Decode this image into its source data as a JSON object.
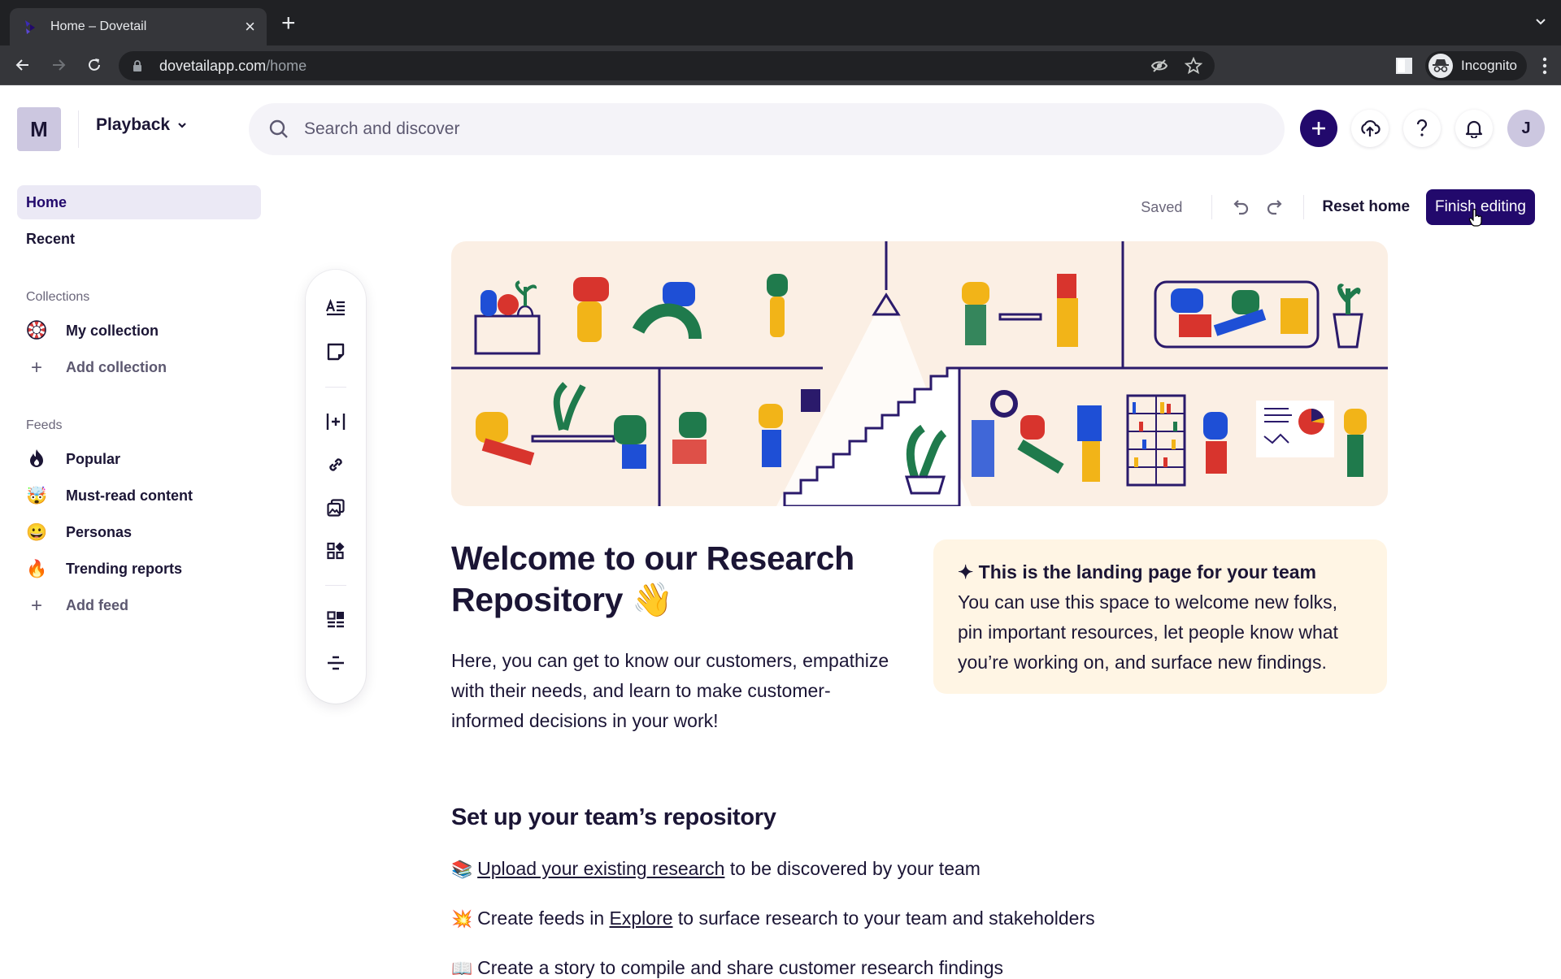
{
  "browser": {
    "tab_title": "Home – Dovetail",
    "new_tab_symbol": "+",
    "close_symbol": "×",
    "url_host": "dovetailapp.com",
    "url_path": "/home",
    "incognito_label": "Incognito"
  },
  "header": {
    "workspace_initial": "M",
    "workspace_name": "Playback",
    "search_placeholder": "Search and discover",
    "user_initial": "J",
    "buttons": [
      "add-icon",
      "upload-cloud-icon",
      "help-icon",
      "bell-icon"
    ]
  },
  "sidebar": {
    "nav": [
      {
        "label": "Home",
        "active": true
      },
      {
        "label": "Recent",
        "active": false
      }
    ],
    "collections_label": "Collections",
    "collections": [
      {
        "emoji": "🛟",
        "label": "My collection"
      }
    ],
    "add_collection": "Add collection",
    "feeds_label": "Feeds",
    "feeds": [
      {
        "emoji": "🔥",
        "label": "Popular",
        "icon": "flame-icon"
      },
      {
        "emoji": "🤯",
        "label": "Must-read content",
        "icon": "exploding-head-icon"
      },
      {
        "emoji": "😀",
        "label": "Personas",
        "icon": "grinning-face-icon"
      },
      {
        "emoji": "🔥",
        "label": "Trending reports",
        "icon": "fire-icon"
      }
    ],
    "add_feed": "Add feed",
    "plus_symbol": "+"
  },
  "toolbar": {
    "blocks": [
      "text-block-icon",
      "note-block-icon",
      "spacer-icon",
      "link-icon",
      "image-icon",
      "widgets-icon",
      "layout-icon",
      "divider-icon"
    ]
  },
  "edit_actions": {
    "status": "Saved",
    "reset_label": "Reset home",
    "finish_label": "Finish editing"
  },
  "content": {
    "title": "Welcome to our Research Repository 👋",
    "body": "Here, you can get to know our customers, empathize with their needs, and learn to make customer-informed decisions in your work!",
    "callout": {
      "title": "✦ This is the landing page for your team",
      "body": "You can use this space to welcome new folks, pin important resources, let people know what you’re working on, and surface new findings."
    },
    "setup_title": "Set up your team’s repository",
    "setup_items": [
      {
        "emoji": "📚",
        "link": "Upload your existing research",
        "pre": "",
        "post": " to be discovered by your team"
      },
      {
        "emoji": "💥",
        "pre": "Create feeds in ",
        "link": "Explore",
        "post": " to surface research to your team and stakeholders"
      },
      {
        "emoji": "📖",
        "pre": "Create a story to compile and share customer research findings",
        "link": "",
        "post": ""
      }
    ]
  },
  "colors": {
    "brand": "#22096c",
    "text": "#1b1535",
    "avatar_bg": "#ccc7e0",
    "active_nav_bg": "#ebe9f5",
    "banner_bg": "#fbefe4",
    "callout_bg": "#fff5e4"
  }
}
